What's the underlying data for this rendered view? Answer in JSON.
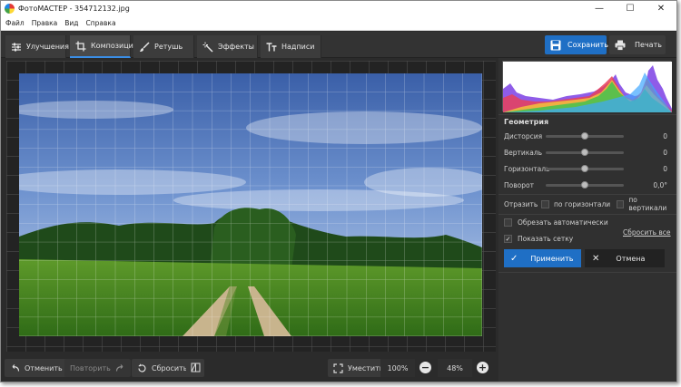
{
  "window": {
    "title": "ФотоМАСТЕР - 354712132.jpg",
    "controls": [
      "—",
      "☐",
      "✕"
    ]
  },
  "menu": [
    "Файл",
    "Правка",
    "Вид",
    "Справка"
  ],
  "tabs": [
    {
      "label": "Улучшения",
      "icon": "sliders-icon",
      "active": false
    },
    {
      "label": "Композиция",
      "icon": "crop-icon",
      "active": true
    },
    {
      "label": "Ретушь",
      "icon": "brush-icon",
      "active": false
    },
    {
      "label": "Эффекты",
      "icon": "magic-wand-icon",
      "active": false
    },
    {
      "label": "Надписи",
      "icon": "text-icon",
      "active": false
    }
  ],
  "toolbar": {
    "save_label": "Сохранить",
    "print_label": "Печать"
  },
  "panel": {
    "section_title": "Геометрия",
    "sliders": [
      {
        "label": "Дисторсия",
        "value": "0",
        "position": 0.5
      },
      {
        "label": "Вертикаль",
        "value": "0",
        "position": 0.5
      },
      {
        "label": "Горизонталь",
        "value": "0",
        "position": 0.5
      },
      {
        "label": "Поворот",
        "value": "0,0°",
        "position": 0.5
      }
    ],
    "mirror": {
      "label": "Отразить",
      "horizontal": "по горизонтали",
      "vertical": "по вертикали"
    },
    "auto_crop": {
      "label": "Обрезать автоматически",
      "checked": false
    },
    "show_grid": {
      "label": "Показать сетку",
      "checked": true
    },
    "reset_all": "Сбросить все",
    "apply_label": "Применить",
    "cancel_label": "Отмена"
  },
  "bottom": {
    "undo": "Отменить",
    "redo": "Повторить",
    "reset": "Сбросить",
    "fit": "Уместить",
    "zoom_100": "100%",
    "zoom_value": "48%",
    "zoom_minus": "−",
    "zoom_plus": "+"
  },
  "colors": {
    "accent": "#1f6fc5",
    "background": "#2b2b2b",
    "panel": "#303030"
  }
}
